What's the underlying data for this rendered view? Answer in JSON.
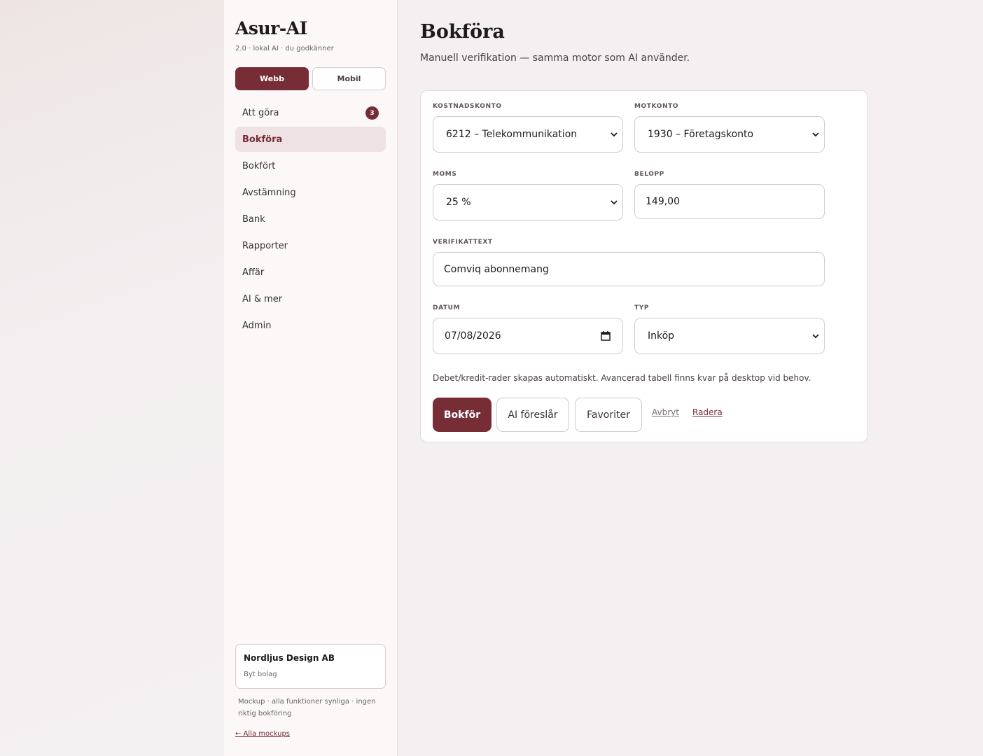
{
  "app": {
    "title": "Asur-AI",
    "subtitle": "2.0 · lokal AI · du godkänner"
  },
  "view_toggle": {
    "web_label": "Webb",
    "mobile_label": "Mobil",
    "selected": "Webb"
  },
  "nav": {
    "items": [
      {
        "label": "Att göra",
        "badge": "3"
      },
      {
        "label": "Bokföra",
        "active": true
      },
      {
        "label": "Bokfört"
      },
      {
        "label": "Avstämning"
      },
      {
        "label": "Bank"
      },
      {
        "label": "Rapporter"
      },
      {
        "label": "Affär"
      },
      {
        "label": "AI & mer"
      },
      {
        "label": "Admin"
      }
    ]
  },
  "company": {
    "name": "Nordljus Design AB",
    "switch_label": "Byt bolag"
  },
  "footer": {
    "note": "Mockup · alla funktioner synliga · ingen riktig bokföring",
    "back_link": "← Alla mockups"
  },
  "page": {
    "title": "Bokföra",
    "subtitle": "Manuell verifikation — samma motor som AI använder."
  },
  "form": {
    "cost_account": {
      "label": "KOSTNADSKONTO",
      "value": "6212 – Telekommunikation"
    },
    "counter_account": {
      "label": "MOTKONTO",
      "value": "1930 – Företagskonto"
    },
    "vat": {
      "label": "MOMS",
      "value": "25 %"
    },
    "amount": {
      "label": "BELOPP",
      "value": "149,00"
    },
    "voucher_text": {
      "label": "VERIFIKATTEXT",
      "value": "Comviq abonnemang"
    },
    "date": {
      "label": "DATUM",
      "value": "07/08/2026"
    },
    "type": {
      "label": "TYP",
      "value": "Inköp"
    },
    "hint": "Debet/kredit-rader skapas automatiskt. Avancerad tabell finns kvar på desktop vid behov."
  },
  "actions": {
    "submit": "Bokför",
    "ai_suggest": "AI föreslår",
    "favorites": "Favoriter",
    "cancel": "Avbryt",
    "delete": "Radera"
  },
  "colors": {
    "accent": "#772d36",
    "sidebar_bg": "#fcf8f8",
    "page_bg": "#f4f0f1",
    "active_nav_bg": "#efe2e4"
  }
}
